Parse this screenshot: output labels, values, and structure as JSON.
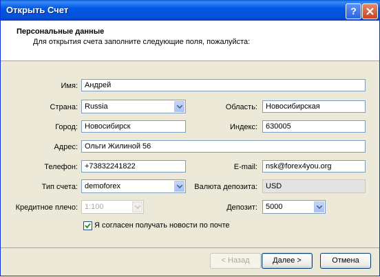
{
  "window": {
    "title": "Открыть Счет",
    "help": "?",
    "close": "✕"
  },
  "header": {
    "title": "Персональные данные",
    "subtitle": "Для открытия счета заполните следующие поля, пожалуйста:"
  },
  "form": {
    "name_label": "Имя:",
    "name": "Андрей",
    "country_label": "Страна:",
    "country": "Russia",
    "region_label": "Область:",
    "region": "Новосибирская",
    "city_label": "Город:",
    "city": "Новосибирск",
    "zip_label": "Индекс:",
    "zip": "630005",
    "address_label": "Адрес:",
    "address": "Ольги Жилиной 56",
    "phone_label": "Телефон:",
    "phone": "+73832241822",
    "email_label": "E-mail:",
    "email": "nsk@forex4you.org",
    "account_type_label": "Тип счета:",
    "account_type": "demoforex",
    "currency_label": "Валюта депозита:",
    "currency": "USD",
    "leverage_label": "Кредитное плечо:",
    "leverage": "1:100",
    "deposit_label": "Депозит:",
    "deposit": "5000",
    "news_label": "Я согласен получать новости по почте",
    "news_checked": true
  },
  "buttons": {
    "back": "< Назад",
    "next": "Далее >",
    "cancel": "Отмена"
  }
}
